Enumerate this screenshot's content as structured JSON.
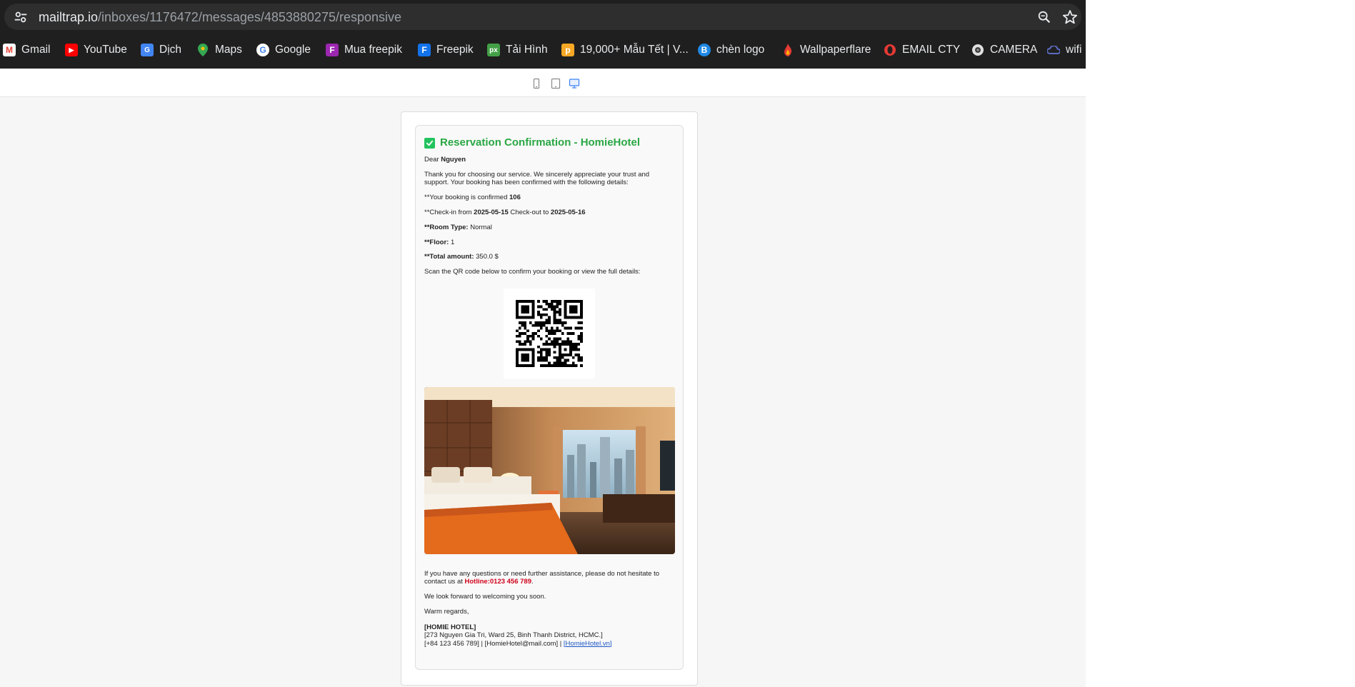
{
  "browser": {
    "url_host": "mailtrap.io",
    "url_path": "/inboxes/1176472/messages/4853880275/responsive",
    "icons": {
      "site_info": "tune-icon",
      "zoom": "zoom-icon",
      "bookmark": "star-icon"
    },
    "bookmarks": [
      {
        "label": "Gmail",
        "icon": "gmail-icon",
        "color": "#ea4335"
      },
      {
        "label": "YouTube",
        "icon": "youtube-icon",
        "color": "#ff0000"
      },
      {
        "label": "Dịch",
        "icon": "translate-icon",
        "color": "#4285f4"
      },
      {
        "label": "Maps",
        "icon": "maps-icon",
        "color": "#34a853"
      },
      {
        "label": "Google",
        "icon": "google-icon",
        "color": "#ffffff"
      },
      {
        "label": "Mua freepik",
        "icon": "freepik-f-icon",
        "color": "#9c27b0"
      },
      {
        "label": "Freepik",
        "icon": "freepik-icon",
        "color": "#1273eb"
      },
      {
        "label": "Tải Hình",
        "icon": "px-icon",
        "color": "#43a047"
      },
      {
        "label": "19,000+ Mẫu Tết | V...",
        "icon": "p-icon",
        "color": "#f9a825"
      },
      {
        "label": "chèn logo",
        "icon": "b-icon",
        "color": "#1e88e5"
      },
      {
        "label": "Wallpaperflare",
        "icon": "flame-icon",
        "color": "#e53935"
      },
      {
        "label": "EMAIL CTY",
        "icon": "opera-icon",
        "color": "#e53935"
      },
      {
        "label": "CAMERA",
        "icon": "camera-icon",
        "color": "#bdbdbd"
      },
      {
        "label": "wifi",
        "icon": "cloud-icon",
        "color": "#3f51b5"
      }
    ]
  },
  "viewer": {
    "device_icons": [
      "mobile-icon",
      "tablet-icon",
      "desktop-icon"
    ],
    "selected_device": "desktop-icon"
  },
  "email": {
    "title": "Reservation Confirmation - HomieHotel",
    "greeting_prefix": "Dear ",
    "guest_name": "Nguyen",
    "intro": "Thank you for choosing our service. We sincerely appreciate your trust and support. Your booking has been confirmed with the following details:",
    "booking_prefix": "**Your booking is confirmed ",
    "booking_id": "106",
    "checkin_prefix": "**Check-in from ",
    "checkin_date": "2025-05-15",
    "checkout_prefix": " Check-out to ",
    "checkout_date": "2025-05-16",
    "room_type_label": "**Room Type:",
    "room_type_value": " Normal",
    "floor_label": "**Floor:",
    "floor_value": " 1",
    "total_label": "**Total amount:",
    "total_value": " 350.0 $",
    "qr_instruction": "Scan the QR code below to confirm your booking or view the full details:",
    "assist_text": "If you have any questions or need further assistance, please do not hesitate to contact us at ",
    "hotline": "Hotline:0123 456 789",
    "assist_suffix": ".",
    "welcome": "We look forward to welcoming you soon.",
    "regards": "Warm regards,",
    "sig_name": "[HOMIE HOTEL]",
    "sig_address": "[273 Nguyen Gia Tri, Ward 25, Binh Thanh District, HCMC.]",
    "sig_contact": "[+84 123 456 789] | [HomieHotel@mail.com] | ",
    "sig_link": "[HomieHotel.vn]",
    "accent_color": "#2aa744",
    "hotline_color": "#d0021b"
  }
}
